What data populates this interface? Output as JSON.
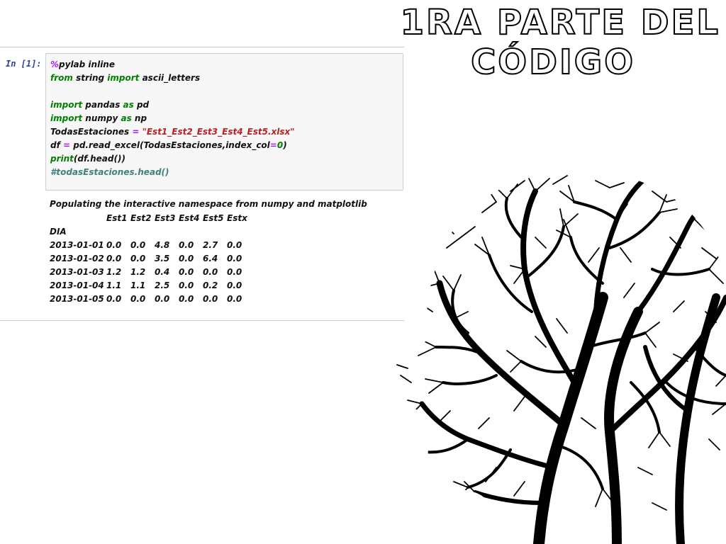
{
  "slide": {
    "title_line1": "1RA PARTE DEL",
    "title_line2": "CÓDIGO"
  },
  "cell": {
    "prompt": "In [1]:",
    "code": {
      "l1_magic": "%",
      "l1_text": "pylab inline",
      "l2_from": "from",
      "l2_mid": " string ",
      "l2_import": "import",
      "l2_end": " ascii_letters",
      "l4_import": "import",
      "l4_mid": " pandas ",
      "l4_as": "as",
      "l4_end": " pd",
      "l5_import": "import",
      "l5_mid": " numpy ",
      "l5_as": "as",
      "l5_end": " np",
      "l6_var": "TodasEstaciones ",
      "l6_eq": "=",
      "l6_str": " \"Est1_Est2_Est3_Est4_Est5.xlsx\"",
      "l7_a": "df ",
      "l7_eq": "=",
      "l7_b": " pd.read_excel(TodasEstaciones,index_col",
      "l7_eq2": "=",
      "l7_zero": "0",
      "l7_c": ")",
      "l8_print": "print",
      "l8_rest": "(df.head())",
      "l9_comment": "#todasEstaciones.head()"
    }
  },
  "output": {
    "message": "Populating the interactive namespace from numpy and matplotlib",
    "columns": [
      "Est1",
      "Est2",
      "Est3",
      "Est4",
      "Est5",
      "Estx"
    ],
    "index_name": "DIA",
    "rows": [
      {
        "idx": "2013-01-01",
        "v": [
          "0.0",
          "0.0",
          "4.8",
          "0.0",
          "2.7",
          "0.0"
        ]
      },
      {
        "idx": "2013-01-02",
        "v": [
          "0.0",
          "0.0",
          "3.5",
          "0.0",
          "6.4",
          "0.0"
        ]
      },
      {
        "idx": "2013-01-03",
        "v": [
          "1.2",
          "1.2",
          "0.4",
          "0.0",
          "0.0",
          "0.0"
        ]
      },
      {
        "idx": "2013-01-04",
        "v": [
          "1.1",
          "1.1",
          "2.5",
          "0.0",
          "0.2",
          "0.0"
        ]
      },
      {
        "idx": "2013-01-05",
        "v": [
          "0.0",
          "0.0",
          "0.0",
          "0.0",
          "0.0",
          "0.0"
        ]
      }
    ]
  },
  "colors": {
    "keyword": "#008000",
    "magic": "#aa22ff",
    "string": "#ba2121",
    "comment": "#408080",
    "prompt": "#303f9f"
  },
  "image": {
    "icon": "tree-brain-head-silhouette"
  }
}
